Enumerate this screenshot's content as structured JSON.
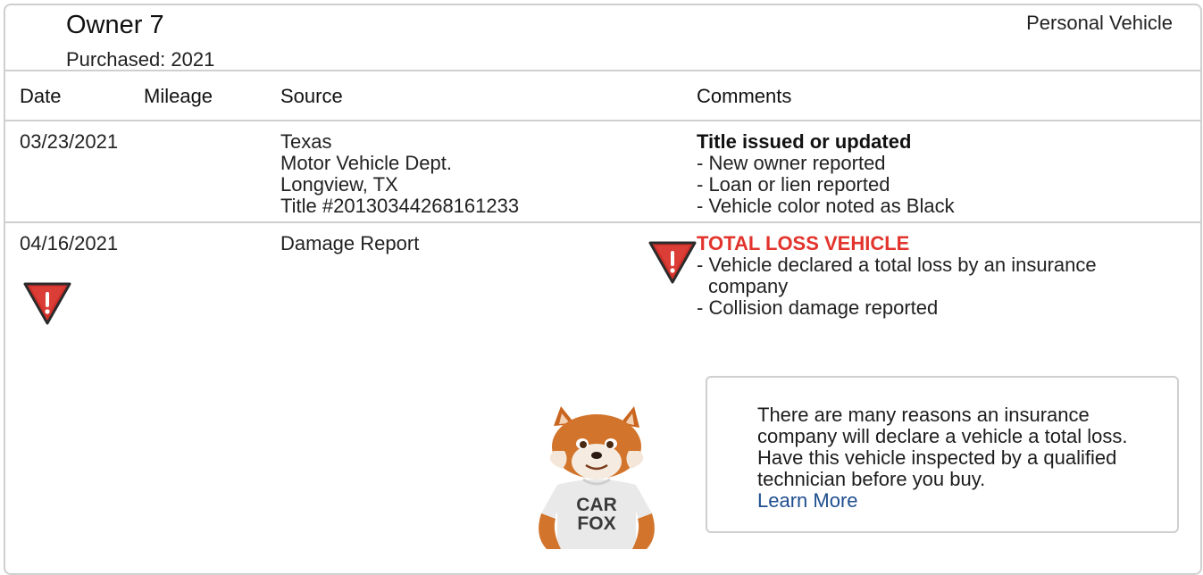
{
  "owner": {
    "title": "Owner 7",
    "purchased": "Purchased: 2021",
    "vehicle_type": "Personal Vehicle"
  },
  "table": {
    "headers": {
      "date": "Date",
      "mileage": "Mileage",
      "source": "Source",
      "comments": "Comments"
    },
    "rows": [
      {
        "date": "03/23/2021",
        "mileage": "",
        "source": [
          "Texas",
          "Motor Vehicle Dept.",
          "Longview, TX",
          "Title #20130344268161233"
        ],
        "comment_title": "Title issued or updated",
        "comments": [
          "- New owner reported",
          "- Loan or lien reported",
          "- Vehicle color noted as Black"
        ]
      },
      {
        "date": "04/16/2021",
        "mileage": "",
        "source": [
          "Damage Report"
        ],
        "comment_title": "TOTAL LOSS VEHICLE",
        "comments": [
          "- Vehicle declared a total loss by an insurance",
          "company",
          "- Collision damage reported"
        ]
      }
    ]
  },
  "callout": {
    "text": "There are many reasons an insurance company will declare a vehicle a total loss. Have this vehicle inspected by a qualified technician before you buy.",
    "link": "Learn More"
  },
  "mascot": {
    "shirt_line1": "CAR",
    "shirt_line2": "FOX"
  },
  "colors": {
    "alert": "#e2342c",
    "warning_icon": "#d3302a",
    "link": "#1f4f8f",
    "border": "#cfcfcf"
  },
  "icons": {
    "warning": "warning-triangle-icon"
  }
}
